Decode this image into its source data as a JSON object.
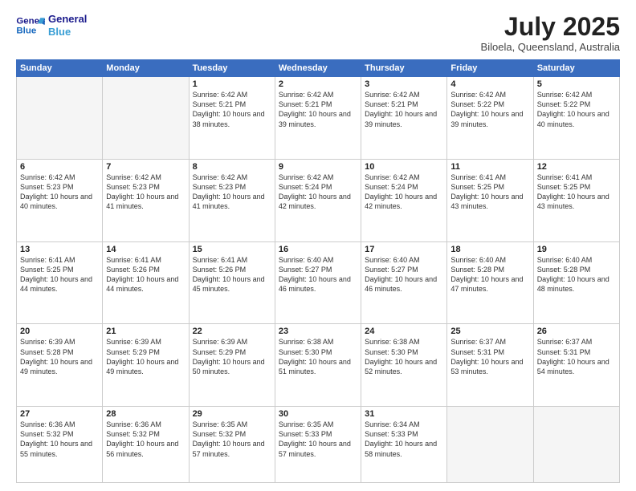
{
  "logo": {
    "line1": "General",
    "line2": "Blue"
  },
  "title": "July 2025",
  "subtitle": "Biloela, Queensland, Australia",
  "weekdays": [
    "Sunday",
    "Monday",
    "Tuesday",
    "Wednesday",
    "Thursday",
    "Friday",
    "Saturday"
  ],
  "weeks": [
    [
      {
        "day": "",
        "detail": ""
      },
      {
        "day": "",
        "detail": ""
      },
      {
        "day": "1",
        "detail": "Sunrise: 6:42 AM\nSunset: 5:21 PM\nDaylight: 10 hours\nand 38 minutes."
      },
      {
        "day": "2",
        "detail": "Sunrise: 6:42 AM\nSunset: 5:21 PM\nDaylight: 10 hours\nand 39 minutes."
      },
      {
        "day": "3",
        "detail": "Sunrise: 6:42 AM\nSunset: 5:21 PM\nDaylight: 10 hours\nand 39 minutes."
      },
      {
        "day": "4",
        "detail": "Sunrise: 6:42 AM\nSunset: 5:22 PM\nDaylight: 10 hours\nand 39 minutes."
      },
      {
        "day": "5",
        "detail": "Sunrise: 6:42 AM\nSunset: 5:22 PM\nDaylight: 10 hours\nand 40 minutes."
      }
    ],
    [
      {
        "day": "6",
        "detail": "Sunrise: 6:42 AM\nSunset: 5:23 PM\nDaylight: 10 hours\nand 40 minutes."
      },
      {
        "day": "7",
        "detail": "Sunrise: 6:42 AM\nSunset: 5:23 PM\nDaylight: 10 hours\nand 41 minutes."
      },
      {
        "day": "8",
        "detail": "Sunrise: 6:42 AM\nSunset: 5:23 PM\nDaylight: 10 hours\nand 41 minutes."
      },
      {
        "day": "9",
        "detail": "Sunrise: 6:42 AM\nSunset: 5:24 PM\nDaylight: 10 hours\nand 42 minutes."
      },
      {
        "day": "10",
        "detail": "Sunrise: 6:42 AM\nSunset: 5:24 PM\nDaylight: 10 hours\nand 42 minutes."
      },
      {
        "day": "11",
        "detail": "Sunrise: 6:41 AM\nSunset: 5:25 PM\nDaylight: 10 hours\nand 43 minutes."
      },
      {
        "day": "12",
        "detail": "Sunrise: 6:41 AM\nSunset: 5:25 PM\nDaylight: 10 hours\nand 43 minutes."
      }
    ],
    [
      {
        "day": "13",
        "detail": "Sunrise: 6:41 AM\nSunset: 5:25 PM\nDaylight: 10 hours\nand 44 minutes."
      },
      {
        "day": "14",
        "detail": "Sunrise: 6:41 AM\nSunset: 5:26 PM\nDaylight: 10 hours\nand 44 minutes."
      },
      {
        "day": "15",
        "detail": "Sunrise: 6:41 AM\nSunset: 5:26 PM\nDaylight: 10 hours\nand 45 minutes."
      },
      {
        "day": "16",
        "detail": "Sunrise: 6:40 AM\nSunset: 5:27 PM\nDaylight: 10 hours\nand 46 minutes."
      },
      {
        "day": "17",
        "detail": "Sunrise: 6:40 AM\nSunset: 5:27 PM\nDaylight: 10 hours\nand 46 minutes."
      },
      {
        "day": "18",
        "detail": "Sunrise: 6:40 AM\nSunset: 5:28 PM\nDaylight: 10 hours\nand 47 minutes."
      },
      {
        "day": "19",
        "detail": "Sunrise: 6:40 AM\nSunset: 5:28 PM\nDaylight: 10 hours\nand 48 minutes."
      }
    ],
    [
      {
        "day": "20",
        "detail": "Sunrise: 6:39 AM\nSunset: 5:28 PM\nDaylight: 10 hours\nand 49 minutes."
      },
      {
        "day": "21",
        "detail": "Sunrise: 6:39 AM\nSunset: 5:29 PM\nDaylight: 10 hours\nand 49 minutes."
      },
      {
        "day": "22",
        "detail": "Sunrise: 6:39 AM\nSunset: 5:29 PM\nDaylight: 10 hours\nand 50 minutes."
      },
      {
        "day": "23",
        "detail": "Sunrise: 6:38 AM\nSunset: 5:30 PM\nDaylight: 10 hours\nand 51 minutes."
      },
      {
        "day": "24",
        "detail": "Sunrise: 6:38 AM\nSunset: 5:30 PM\nDaylight: 10 hours\nand 52 minutes."
      },
      {
        "day": "25",
        "detail": "Sunrise: 6:37 AM\nSunset: 5:31 PM\nDaylight: 10 hours\nand 53 minutes."
      },
      {
        "day": "26",
        "detail": "Sunrise: 6:37 AM\nSunset: 5:31 PM\nDaylight: 10 hours\nand 54 minutes."
      }
    ],
    [
      {
        "day": "27",
        "detail": "Sunrise: 6:36 AM\nSunset: 5:32 PM\nDaylight: 10 hours\nand 55 minutes."
      },
      {
        "day": "28",
        "detail": "Sunrise: 6:36 AM\nSunset: 5:32 PM\nDaylight: 10 hours\nand 56 minutes."
      },
      {
        "day": "29",
        "detail": "Sunrise: 6:35 AM\nSunset: 5:32 PM\nDaylight: 10 hours\nand 57 minutes."
      },
      {
        "day": "30",
        "detail": "Sunrise: 6:35 AM\nSunset: 5:33 PM\nDaylight: 10 hours\nand 57 minutes."
      },
      {
        "day": "31",
        "detail": "Sunrise: 6:34 AM\nSunset: 5:33 PM\nDaylight: 10 hours\nand 58 minutes."
      },
      {
        "day": "",
        "detail": ""
      },
      {
        "day": "",
        "detail": ""
      }
    ]
  ]
}
